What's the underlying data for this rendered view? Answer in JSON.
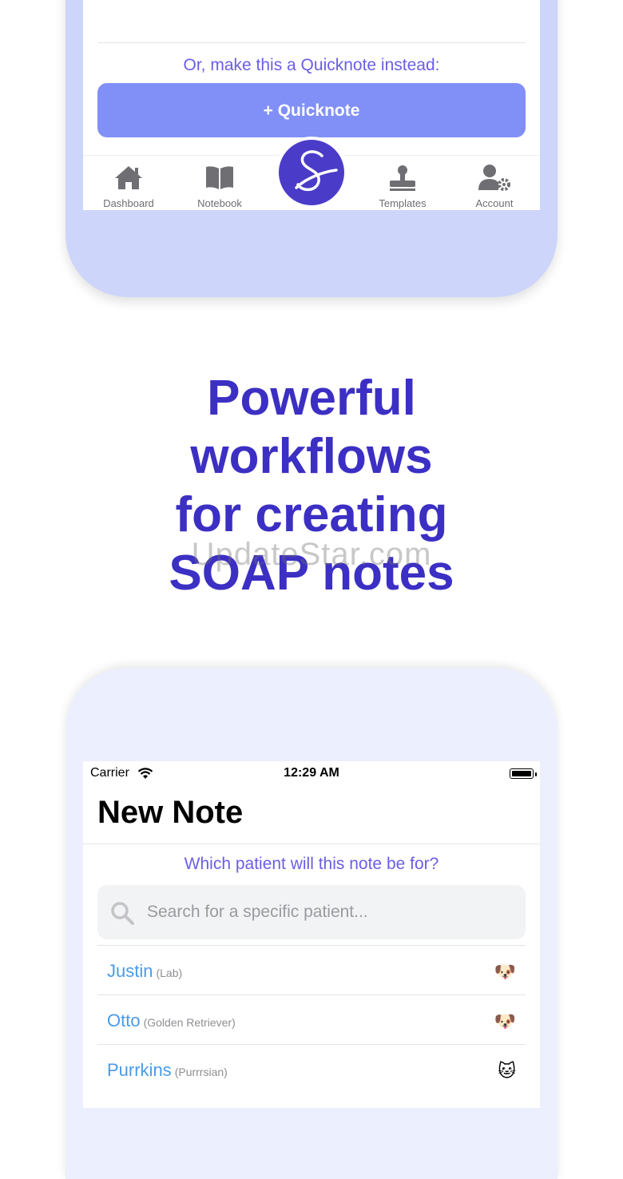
{
  "top_screen": {
    "quicknote_prompt": "Or, make this a Quicknote instead:",
    "quicknote_button": "+ Quicknote",
    "tabs": [
      {
        "label": "Dashboard",
        "icon": "home-icon"
      },
      {
        "label": "Notebook",
        "icon": "book-icon"
      },
      {
        "label": "Templates",
        "icon": "stamp-icon"
      },
      {
        "label": "Account",
        "icon": "user-gear-icon"
      }
    ],
    "center_button_icon": "script-s-logo-icon"
  },
  "headline": {
    "line1": "Powerful",
    "line2": "workflows",
    "line3": "for creating",
    "line4": "SOAP notes"
  },
  "watermark": "UpdateStar.com",
  "bottom_screen": {
    "status_bar": {
      "carrier": "Carrier",
      "time": "12:29 AM"
    },
    "title": "New Note",
    "patient_question": "Which patient will this note be for?",
    "search": {
      "placeholder": "Search for a specific patient..."
    },
    "patients": [
      {
        "name": "Justin",
        "breed": "(Lab)",
        "emoji": "🐶"
      },
      {
        "name": "Otto",
        "breed": "(Golden Retriever)",
        "emoji": "🐶"
      },
      {
        "name": "Purrkins",
        "breed": "(Purrrsian)",
        "emoji": "🐱"
      }
    ]
  },
  "colors": {
    "accent_purple": "#3c2fc4",
    "prompt_purple": "#6a5ee6",
    "button_blue": "#8190f7",
    "frame_lavender": "#cdd5fb",
    "link_blue": "#4a9be8"
  }
}
